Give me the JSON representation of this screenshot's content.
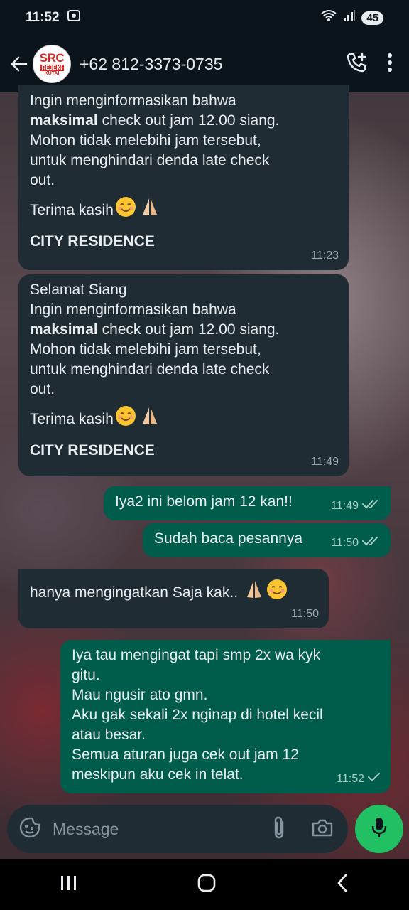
{
  "status": {
    "time": "11:52",
    "battery": "45"
  },
  "header": {
    "contact": "+62 812-3373-0735",
    "avatar_text": "SRC",
    "avatar_sub": "REJEKI",
    "avatar_sub2": "KUTAI"
  },
  "messages": [
    {
      "dir": "in",
      "lines": [
        "Ingin menginformasikan bahwa"
      ],
      "bold_line": {
        "bold": "maksimal",
        "rest": " check out jam 12.00 siang."
      },
      "lines2": [
        "Mohon tidak melebihi jam tersebut,",
        "untuk menghindari denda late check",
        "out."
      ],
      "thanks": "Terima kasih",
      "signature": "CITY RESIDENCE",
      "time": "11:23"
    },
    {
      "dir": "in",
      "greeting": "Selamat Siang",
      "lines": [
        "Ingin menginformasikan bahwa"
      ],
      "bold_line": {
        "bold": "maksimal",
        "rest": " check out jam 12.00 siang."
      },
      "lines2": [
        "Mohon tidak melebihi jam tersebut,",
        "untuk menghindari denda late check",
        "out."
      ],
      "thanks": "Terima kasih",
      "signature": "CITY RESIDENCE",
      "time": "11:49"
    },
    {
      "dir": "out",
      "text": "Iya2 ini belom jam 12 kan!!",
      "time": "11:49"
    },
    {
      "dir": "out",
      "text": "Sudah baca pesannya",
      "time": "11:50"
    },
    {
      "dir": "in",
      "text": "hanya mengingatkan Saja kak..",
      "time": "11:50"
    },
    {
      "dir": "out",
      "lines": [
        "Iya tau mengingat tapi smp 2x wa kyk",
        "gitu.",
        "Mau ngusir ato gmn.",
        "Aku gak sekali 2x nginap di hotel kecil",
        "atau besar.",
        "Semua aturan juga cek out jam 12",
        "meskipun aku cek in telat."
      ],
      "time": "11:52"
    }
  ],
  "composer": {
    "placeholder": "Message"
  },
  "colors": {
    "incoming": "#1f2c34",
    "outgoing": "#005c4b",
    "accent": "#21c063",
    "bar": "#0b141a"
  },
  "icons": [
    "back-arrow-icon",
    "add-call-icon",
    "more-vert-icon",
    "sticker-icon",
    "attach-icon",
    "camera-icon",
    "mic-icon",
    "recents-icon",
    "home-icon",
    "nav-back-icon"
  ]
}
